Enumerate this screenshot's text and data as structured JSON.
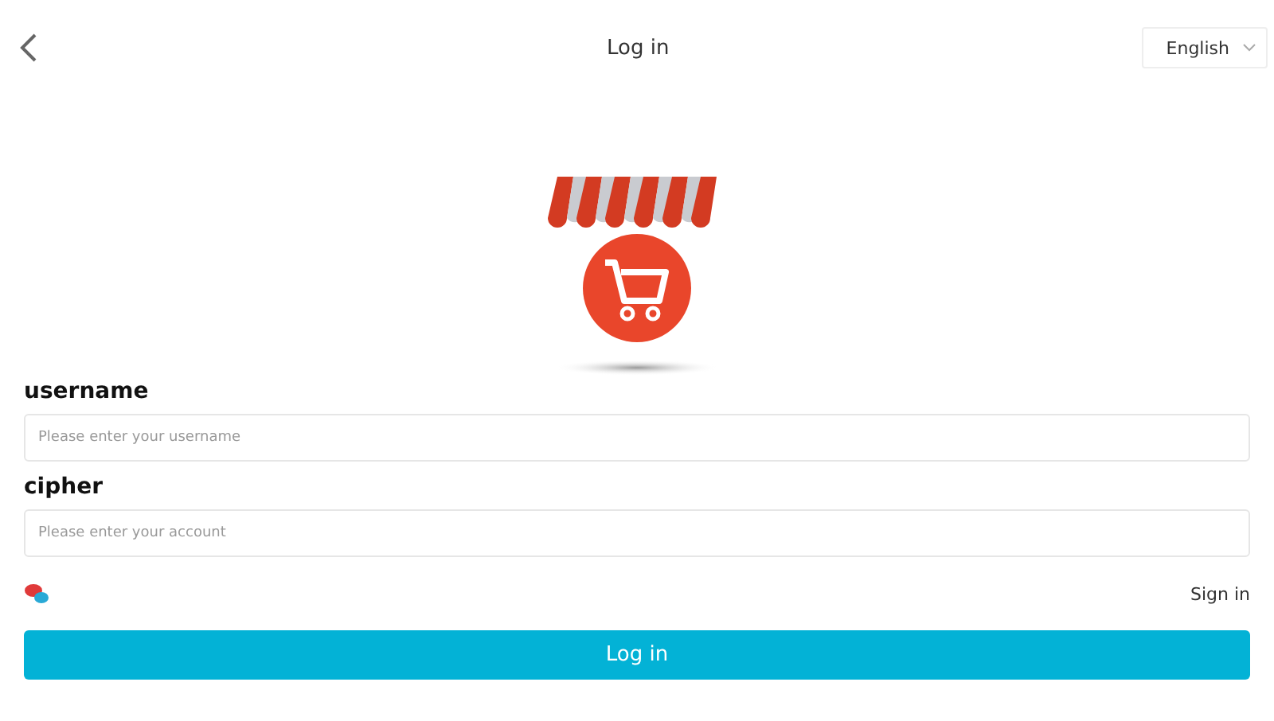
{
  "header": {
    "title": "Log in",
    "language": "English"
  },
  "fields": [
    {
      "label": "username",
      "placeholder": "Please enter your username"
    },
    {
      "label": "cipher",
      "placeholder": "Please enter your account"
    }
  ],
  "sign_in_link": "Sign in",
  "submit_button": "Log in"
}
